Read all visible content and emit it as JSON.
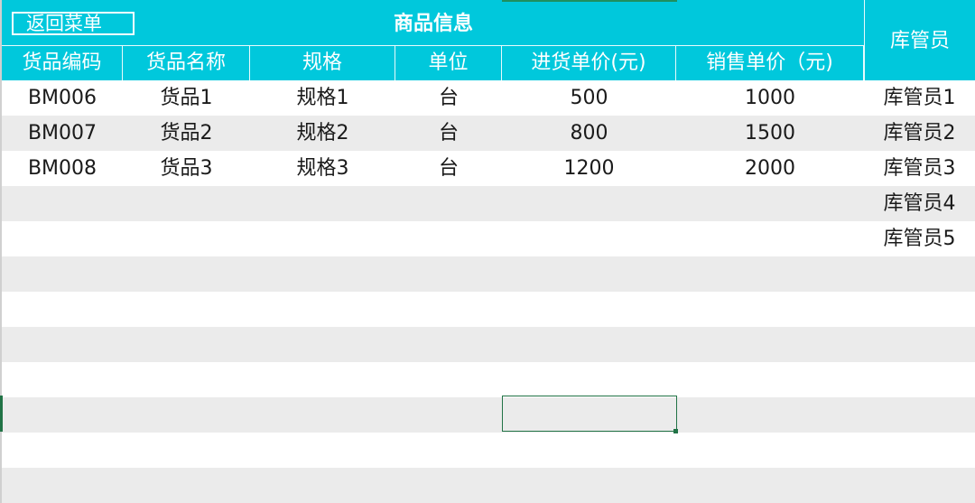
{
  "header": {
    "back_button": "返回菜单",
    "title": "商品信息",
    "keeper_column": "库管员"
  },
  "columns": [
    "货品编码",
    "货品名称",
    "规格",
    "单位",
    "进货单价(元)",
    "销售单价（元)"
  ],
  "rows": [
    {
      "code": "BM006",
      "name": "货品1",
      "spec": "规格1",
      "unit": "台",
      "purchase_price": "500",
      "sale_price": "1000",
      "keeper": "库管员1"
    },
    {
      "code": "BM007",
      "name": "货品2",
      "spec": "规格2",
      "unit": "台",
      "purchase_price": "800",
      "sale_price": "1500",
      "keeper": "库管员2"
    },
    {
      "code": "BM008",
      "name": "货品3",
      "spec": "规格3",
      "unit": "台",
      "purchase_price": "1200",
      "sale_price": "2000",
      "keeper": "库管员3"
    },
    {
      "code": "",
      "name": "",
      "spec": "",
      "unit": "",
      "purchase_price": "",
      "sale_price": "",
      "keeper": "库管员4"
    },
    {
      "code": "",
      "name": "",
      "spec": "",
      "unit": "",
      "purchase_price": "",
      "sale_price": "",
      "keeper": "库管员5"
    },
    {
      "code": "",
      "name": "",
      "spec": "",
      "unit": "",
      "purchase_price": "",
      "sale_price": "",
      "keeper": ""
    },
    {
      "code": "",
      "name": "",
      "spec": "",
      "unit": "",
      "purchase_price": "",
      "sale_price": "",
      "keeper": ""
    },
    {
      "code": "",
      "name": "",
      "spec": "",
      "unit": "",
      "purchase_price": "",
      "sale_price": "",
      "keeper": ""
    },
    {
      "code": "",
      "name": "",
      "spec": "",
      "unit": "",
      "purchase_price": "",
      "sale_price": "",
      "keeper": ""
    },
    {
      "code": "",
      "name": "",
      "spec": "",
      "unit": "",
      "purchase_price": "",
      "sale_price": "",
      "keeper": ""
    },
    {
      "code": "",
      "name": "",
      "spec": "",
      "unit": "",
      "purchase_price": "",
      "sale_price": "",
      "keeper": ""
    },
    {
      "code": "",
      "name": "",
      "spec": "",
      "unit": "",
      "purchase_price": "",
      "sale_price": "",
      "keeper": ""
    }
  ],
  "colors": {
    "header": "#00c8dc",
    "alt_row": "#ebebeb",
    "selection": "#217346"
  }
}
